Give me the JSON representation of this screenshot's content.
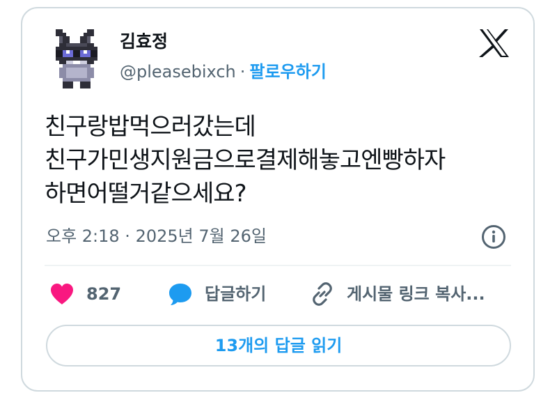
{
  "author": {
    "display_name": "김효정",
    "handle": "@pleasebixch",
    "separator": "·",
    "follow_label": "팔로우하기",
    "avatar_icon": "pixel-rabbit-avatar"
  },
  "platform": {
    "logo_icon": "x-logo-icon"
  },
  "tweet": {
    "lines": [
      "친구랑밥먹으러갔는데",
      "친구가민생지원금으로결제해놓고엔빵하자",
      "하면어떨거같으세요?"
    ],
    "timestamp": "오후 2:18 · 2025년 7월 26일"
  },
  "actions": {
    "like_count": "827",
    "reply_label": "답글하기",
    "copy_link_label": "게시물 링크 복사..."
  },
  "replies_button": {
    "label": "13개의 답글 읽기"
  },
  "colors": {
    "accent": "#1d9bf0",
    "like": "#f91880",
    "text": "#0f1419",
    "secondary": "#536471",
    "border": "#cfd9de"
  }
}
